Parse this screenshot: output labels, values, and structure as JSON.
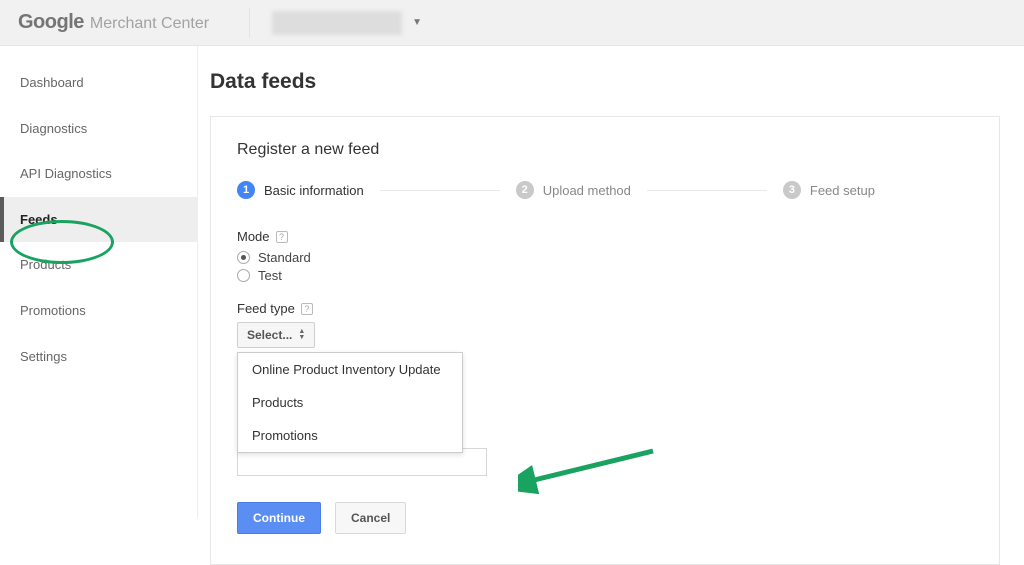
{
  "header": {
    "logo_google": "Google",
    "logo_product": "Merchant Center"
  },
  "sidebar": {
    "items": [
      {
        "label": "Dashboard"
      },
      {
        "label": "Diagnostics"
      },
      {
        "label": "API Diagnostics"
      },
      {
        "label": "Feeds"
      },
      {
        "label": "Products"
      },
      {
        "label": "Promotions"
      },
      {
        "label": "Settings"
      }
    ],
    "active_index": 3
  },
  "page": {
    "title": "Data feeds",
    "card_title": "Register a new feed"
  },
  "stepper": {
    "steps": [
      {
        "num": "1",
        "label": "Basic information"
      },
      {
        "num": "2",
        "label": "Upload method"
      },
      {
        "num": "3",
        "label": "Feed setup"
      }
    ],
    "active_index": 0
  },
  "mode_section": {
    "label": "Mode",
    "options": [
      {
        "label": "Standard",
        "checked": true
      },
      {
        "label": "Test",
        "checked": false
      }
    ]
  },
  "feed_type": {
    "label": "Feed type",
    "select_label": "Select...",
    "options": [
      "Online Product Inventory Update",
      "Products",
      "Promotions"
    ]
  },
  "buttons": {
    "continue": "Continue",
    "cancel": "Cancel"
  }
}
